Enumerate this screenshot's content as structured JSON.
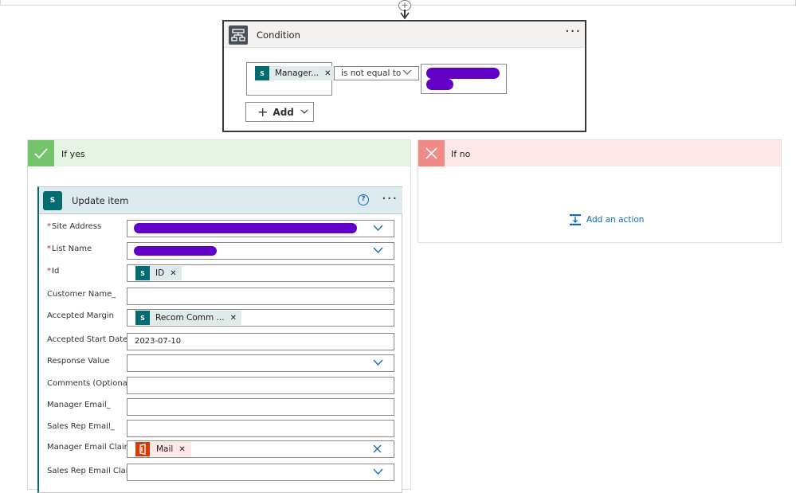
{
  "condition": {
    "title": "Condition",
    "more": "···",
    "left_token": "Manager...",
    "operator": "is not equal to",
    "add_label": "Add"
  },
  "branches": {
    "yes_title": "If yes",
    "no_title": "If no",
    "add_action": "Add an action"
  },
  "update_item": {
    "title": "Update item",
    "more": "···",
    "fields": {
      "site_address": "Site Address",
      "list_name": "List Name",
      "id": "Id",
      "customer_name": "Customer Name_",
      "accepted_margin": "Accepted Margin",
      "accepted_start_date": "Accepted Start Date",
      "response_value": "Response Value",
      "comments": "Comments (Optional)",
      "manager_email": "Manager Email_",
      "sales_rep_email": "Sales Rep Email_",
      "manager_email_claims": "Manager Email Claims",
      "sales_rep_email_claims": "Sales Rep Email Claims"
    },
    "values": {
      "id_token": "ID",
      "margin_token": "Recom Comm ...",
      "start_date": "2023-07-10",
      "mail_token": "Mail"
    }
  },
  "icons": [
    "condition-icon",
    "sharepoint-icon",
    "checkmark-icon",
    "close-icon",
    "office-icon",
    "help-icon",
    "add-action-icon"
  ],
  "colors": {
    "accent": "#0f6cbd",
    "sharepoint": "#036c70",
    "yes": "#73c46a",
    "no": "#f28b87",
    "redaction": "#6200c8",
    "office": "#d83b01"
  }
}
